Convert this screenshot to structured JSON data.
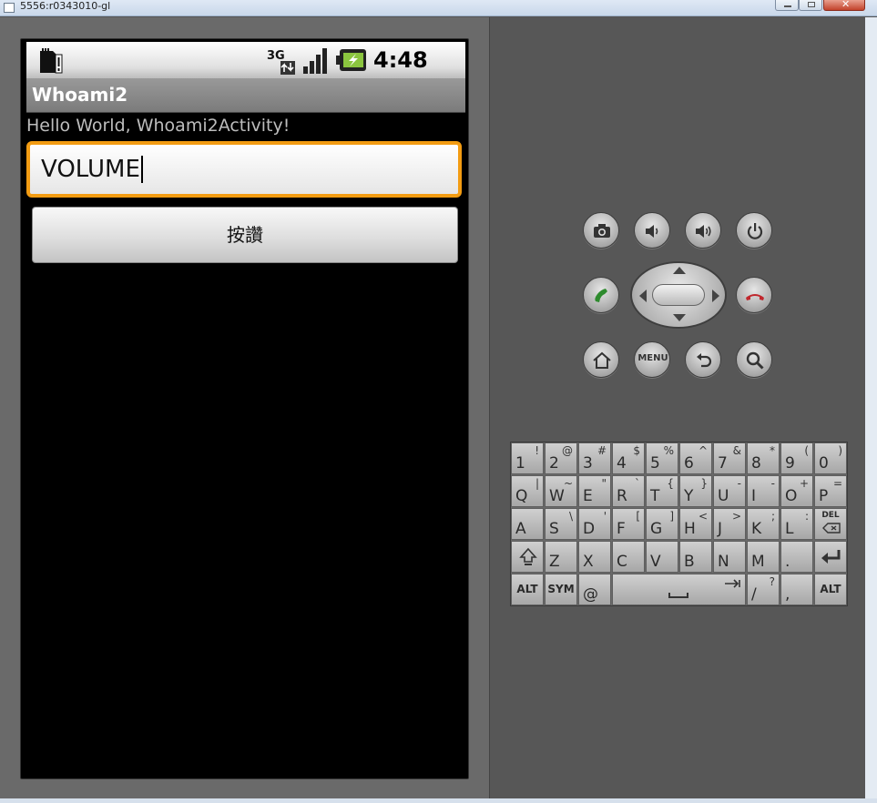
{
  "window": {
    "title": "5556:r0343010-gl"
  },
  "statusbar": {
    "time": "4:48 PM",
    "network": "3G"
  },
  "app": {
    "title": "Whoami2",
    "hello": "Hello World, Whoami2Activity!",
    "input_value": "VOLUME",
    "button_label": "按讚"
  },
  "controls": {
    "row1": [
      "camera-icon",
      "volume-down-icon",
      "volume-up-icon",
      "power-icon"
    ],
    "dpad": [
      "call-icon",
      "dpad",
      "end-call-icon"
    ],
    "row3": [
      "home-icon",
      "menu-button",
      "back-icon",
      "search-icon"
    ],
    "menu_label": "MENU"
  },
  "colors": {
    "focus": "#f39c12",
    "call": "#2e8b2e",
    "end_call": "#c0272d"
  },
  "keyboard": {
    "row1": [
      {
        "main": "1",
        "alt": "!"
      },
      {
        "main": "2",
        "alt": "@"
      },
      {
        "main": "3",
        "alt": "#"
      },
      {
        "main": "4",
        "alt": "$"
      },
      {
        "main": "5",
        "alt": "%"
      },
      {
        "main": "6",
        "alt": "^"
      },
      {
        "main": "7",
        "alt": "&"
      },
      {
        "main": "8",
        "alt": "*"
      },
      {
        "main": "9",
        "alt": "("
      },
      {
        "main": "0",
        "alt": ")"
      }
    ],
    "row2": [
      {
        "main": "Q",
        "alt": "|"
      },
      {
        "main": "W",
        "alt": "~"
      },
      {
        "main": "E",
        "alt": "\""
      },
      {
        "main": "R",
        "alt": "`"
      },
      {
        "main": "T",
        "alt": "{"
      },
      {
        "main": "Y",
        "alt": "}"
      },
      {
        "main": "U",
        "alt": "-"
      },
      {
        "main": "I",
        "alt": "-"
      },
      {
        "main": "O",
        "alt": "+"
      },
      {
        "main": "P",
        "alt": "="
      }
    ],
    "row3": [
      {
        "main": "A",
        "alt": ""
      },
      {
        "main": "S",
        "alt": "\\"
      },
      {
        "main": "D",
        "alt": "'"
      },
      {
        "main": "F",
        "alt": "["
      },
      {
        "main": "G",
        "alt": "]"
      },
      {
        "main": "H",
        "alt": "<"
      },
      {
        "main": "J",
        "alt": ">"
      },
      {
        "main": "K",
        "alt": ";"
      },
      {
        "main": "L",
        "alt": ":"
      }
    ],
    "row4": [
      {
        "main": "Z",
        "alt": ""
      },
      {
        "main": "X",
        "alt": ""
      },
      {
        "main": "C",
        "alt": ""
      },
      {
        "main": "V",
        "alt": ""
      },
      {
        "main": "B",
        "alt": ""
      },
      {
        "main": "N",
        "alt": ""
      },
      {
        "main": "M",
        "alt": ""
      },
      {
        "main": ".",
        "alt": ""
      }
    ],
    "row5": {
      "alt_left": "ALT",
      "sym": "SYM",
      "at": "@",
      "slash": "/",
      "question": "?",
      "comma": ",",
      "alt_right": "ALT"
    },
    "del_label": "DEL"
  }
}
